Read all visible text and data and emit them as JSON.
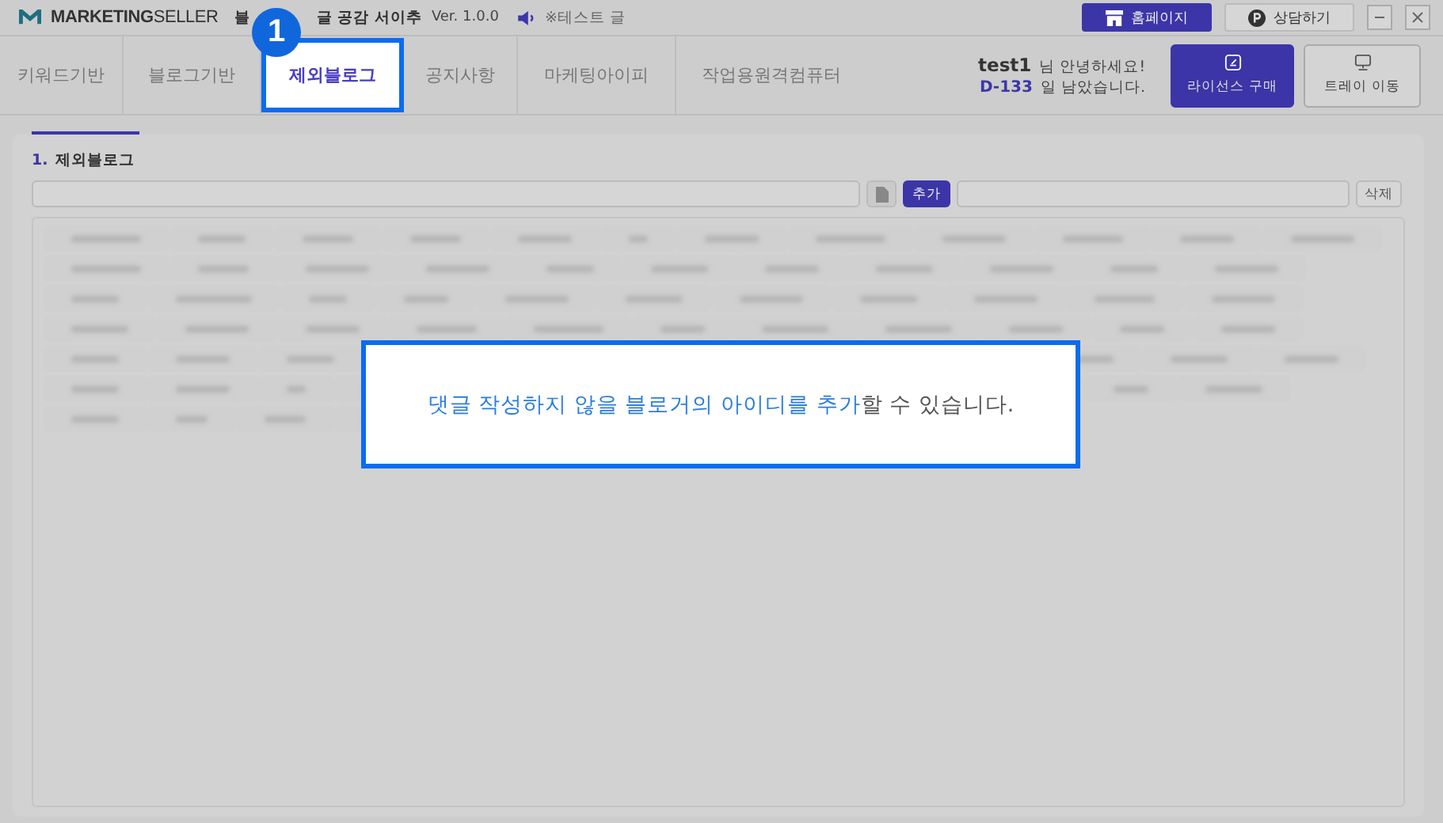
{
  "app": {
    "brand_bold": "MARKETING",
    "brand_light": "SELLER",
    "title_start": "블",
    "title_end": "글 공감 서이추",
    "version": "Ver. 1.0.0",
    "notice": "※테스트 글"
  },
  "top_buttons": [
    {
      "label": "홈페이지",
      "kind": "primary"
    },
    {
      "label": "상담하기",
      "kind": "plain"
    }
  ],
  "step_badge": "1",
  "tabs": [
    {
      "label": "키워드기반",
      "selected": false
    },
    {
      "label": "블로그기반",
      "selected": false
    },
    {
      "label": "제외블로그",
      "selected": true
    },
    {
      "label": "공지사항",
      "selected": false
    },
    {
      "label": "마케팅아이피",
      "selected": false
    },
    {
      "label": "작업용원격컴퓨터",
      "selected": false
    }
  ],
  "user": {
    "name": "test1",
    "greeting": "님 안녕하세요!",
    "days": "D-133",
    "days_suffix": "일 남았습니다."
  },
  "actions": [
    {
      "label": "라이선스 구매",
      "kind": "primary"
    },
    {
      "label": "트레이 이동",
      "kind": "plain"
    }
  ],
  "section": {
    "number": "1.",
    "title": "제외블로그",
    "add_button": "추가",
    "delete_button": "삭제"
  },
  "callout": [
    {
      "text": "댓글 작성하지 않을 블로거의 아이디를 추가",
      "highlight": true
    },
    {
      "text": "할 수 있습니다.",
      "highlight": false
    }
  ]
}
